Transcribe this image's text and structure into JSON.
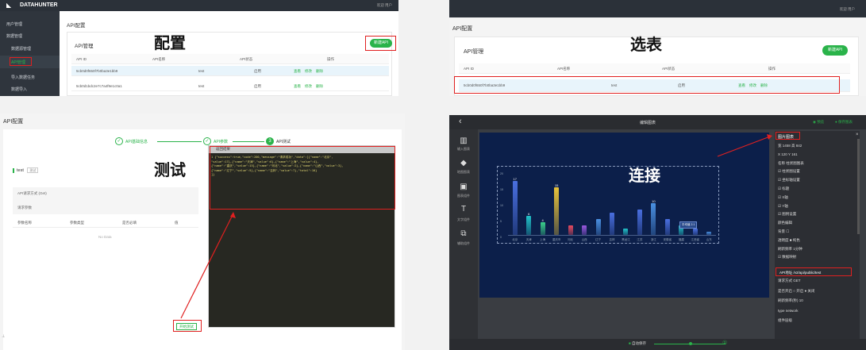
{
  "p1": {
    "brand": "DATAHUNTER",
    "top_right": "欢迎 用户",
    "section_title": "API配置",
    "annotation": "配置",
    "sidebar": [
      "用户管理",
      "数据管理",
      "数据源管理",
      "API管理",
      "导入数据任务",
      "数据导入"
    ],
    "panel_title": "API管理",
    "add_button": "新建API",
    "columns": [
      "API ID",
      "API名称",
      "API状态",
      "操作"
    ],
    "rows": [
      {
        "id": "5cb0d0f650f7b0ba3e1bb9",
        "name": "test",
        "status": "启用",
        "ops": [
          "查看",
          "修改",
          "删除"
        ]
      },
      {
        "id": "5cb0d1bdc2e7c7a4f9e1c0a1",
        "name": "test",
        "status": "启用",
        "ops": [
          "查看",
          "修改",
          "删除"
        ]
      }
    ]
  },
  "p2": {
    "top_right": "欢迎 用户",
    "section_title": "API配置",
    "annotation": "选表",
    "panel_title": "API管理",
    "add_button": "新建API",
    "columns": [
      "API ID",
      "API名称",
      "API状态",
      "操作"
    ],
    "row": {
      "id": "5cb0d0f650f7b0ba3e1bb9",
      "name": "test",
      "status": "启用",
      "ops": [
        "查看",
        "修改",
        "删除"
      ]
    }
  },
  "p3": {
    "section_title": "API配置",
    "annotation": "测试",
    "steps": [
      {
        "num": "✓",
        "label": "API基础信息"
      },
      {
        "num": "✓",
        "label": "API参数"
      },
      {
        "num": "3",
        "label": "API测试"
      }
    ],
    "api_name": "test",
    "api_tag": "测试",
    "info_row1": "API请求方式 (Get)",
    "info_row2": "请求参数",
    "param_columns": [
      "参数名称",
      "参数类型",
      "是否必填",
      "值"
    ],
    "no_data": "No Data",
    "result_header": "返回结果",
    "result_lines": [
      "1  {\"success\":true,\"code\":200,\"message\":\"请求成功\",\"data\":[{\"name\":\"北京\",",
      "   \"value\":17},{\"name\":\"天津\",\"value\":6},{\"name\":\"上海\",\"value\":4},",
      "   {\"name\":\"重庆\",\"value\":15},{\"name\":\"河北\",\"value\":2},{\"name\":\"山西\",\"value\":3},",
      "   {\"name\":\"辽宁\",\"value\":5},{\"name\":\"吉林\",\"value\":7},\"total\":10}",
      "   ]}"
    ],
    "test_button": "开始测试"
  },
  "p4": {
    "title": "编辑图表",
    "back": "‹",
    "preview": "预览",
    "save": "保存图表",
    "tools": [
      "输入图表",
      "地图图表",
      "图表组件",
      "文字组件",
      "辅助组件"
    ],
    "annotation": "连接",
    "props_header": "图片图表",
    "props": [
      "宽 1458    高 842",
      "X 120      Y 161",
      "名称  柱状图图表",
      "☑ 柱状图设置",
      "☑ 坐标轴设置",
      "☑ 标题",
      "☑ X轴",
      "☑ Y轴",
      "☑ 图例设置",
      "颜色编辑",
      "背景      ☐",
      "透明度  ■ 纯色",
      "刷新频率 1分钟",
      "☑ 数据映射"
    ],
    "api_field": "API地址  /v2/api/public/test",
    "props_after": [
      "请求方式 GET",
      "是否开启 ○ 开启 ● 关闭",
      "刷新频率(秒) 10",
      "type    network",
      "组件层级"
    ],
    "bottom_label": "自动保存",
    "bottom_step": "①",
    "tooltip": "平均值 2.1"
  },
  "chart_data": {
    "type": "bar",
    "categories": [
      "北京",
      "天津",
      "上海",
      "重庆市",
      "河北",
      "山西",
      "辽宁",
      "吉林",
      "黑龙江",
      "江苏",
      "浙江",
      "安徽省",
      "福建",
      "江西省",
      "山东"
    ],
    "values": [
      17,
      6,
      4,
      15,
      3,
      3,
      5,
      7,
      2,
      8,
      10,
      5,
      3,
      2,
      1
    ],
    "labels_shown": [
      "17",
      "6",
      "4",
      "15",
      "",
      "",
      "",
      "",
      "",
      "",
      "10",
      "",
      "",
      "",
      ""
    ],
    "ylim": [
      0,
      20
    ],
    "yticks": [
      "20",
      "15",
      "10",
      "5",
      "0"
    ],
    "colors": [
      "#4a6fe0",
      "#22c3c9",
      "#3bd18b",
      "#e8c23a",
      "#e84a5f",
      "#9b59e0",
      "#4a90e2",
      "#4a6fe0",
      "#22c3c9",
      "#4a6fe0",
      "#4a90e2",
      "#4a6fe0",
      "#22c3c9",
      "#4a6fe0",
      "#4a90e2"
    ]
  }
}
